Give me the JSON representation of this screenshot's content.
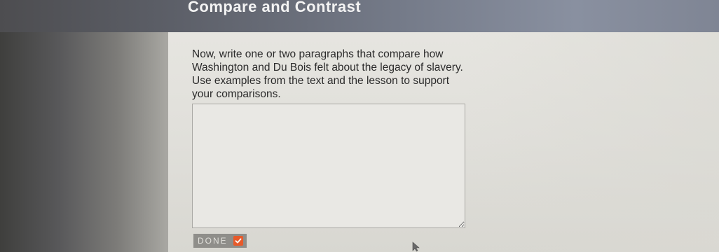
{
  "header": {
    "title": "Compare and Contrast"
  },
  "prompt": {
    "text": "Now, write one or two paragraphs that compare how Washington and Du Bois felt about the legacy of slavery. Use examples from the text and the lesson to support your comparisons."
  },
  "answer": {
    "value": "",
    "placeholder": ""
  },
  "done_button": {
    "label": "DONE",
    "icon": "checkmark-icon"
  },
  "colors": {
    "header": "#6b7080",
    "done_check": "#e85a2a",
    "done_bg": "#8f8e8a"
  }
}
